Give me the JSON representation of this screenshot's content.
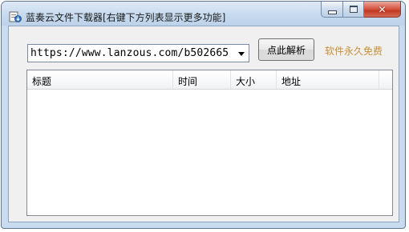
{
  "window": {
    "title": "蓝奏云文件下载器[右键下方列表显示更多功能]",
    "icons": {
      "app": "download-app-icon",
      "minimize": "minimize-icon",
      "maximize": "maximize-icon",
      "close": "close-icon"
    }
  },
  "url_combo": {
    "value": "https://www.lanzous.com/b502665",
    "arrow_icon": "dropdown-arrow-icon"
  },
  "parse_button": {
    "label": "点此解析"
  },
  "free_label": {
    "text": "软件永久免费",
    "color": "#c89037"
  },
  "list": {
    "columns": [
      "标题",
      "时间",
      "大小",
      "地址"
    ],
    "rows": []
  }
}
